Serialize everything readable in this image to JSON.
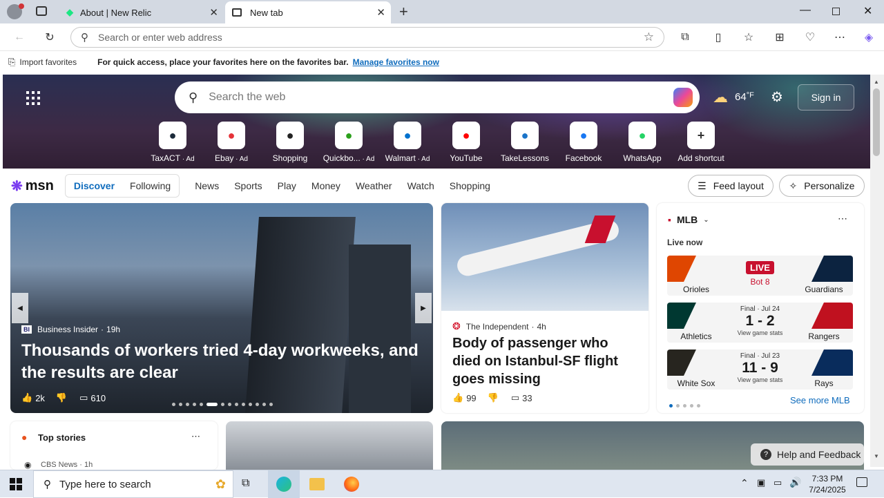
{
  "browser": {
    "tabs": [
      {
        "title": "About | New Relic"
      },
      {
        "title": "New tab"
      }
    ],
    "address_placeholder": "Search or enter web address"
  },
  "favbar": {
    "import_label": "Import favorites",
    "message": "For quick access, place your favorites here on the favorites bar.",
    "manage_link": "Manage favorites now"
  },
  "hero": {
    "search_placeholder": "Search the web",
    "weather_temp": "64",
    "weather_unit": "°F",
    "sign_in": "Sign in",
    "quicklinks": [
      {
        "label": "TaxACT",
        "ad": " · Ad",
        "icon": "taxact-icon",
        "color": "#1b2a3a"
      },
      {
        "label": "Ebay",
        "ad": " · Ad",
        "icon": "ebay-icon",
        "color": "#e53238"
      },
      {
        "label": "Shopping",
        "ad": "",
        "icon": "tag-icon",
        "color": "#222"
      },
      {
        "label": "Quickbo...",
        "ad": " · Ad",
        "icon": "quickbooks-icon",
        "color": "#2ca01c"
      },
      {
        "label": "Walmart",
        "ad": " · Ad",
        "icon": "walmart-icon",
        "color": "#0071ce"
      },
      {
        "label": "YouTube",
        "ad": "",
        "icon": "youtube-icon",
        "color": "#ff0000"
      },
      {
        "label": "TakeLessons",
        "ad": "",
        "icon": "takelessons-icon",
        "color": "#1a73c8"
      },
      {
        "label": "Facebook",
        "ad": "",
        "icon": "facebook-icon",
        "color": "#1877f2"
      },
      {
        "label": "WhatsApp",
        "ad": "",
        "icon": "whatsapp-icon",
        "color": "#25d366"
      },
      {
        "label": "Add shortcut",
        "ad": "",
        "icon": "plus-icon",
        "color": "#333"
      }
    ]
  },
  "msn": {
    "logo": "msn",
    "discover": "Discover",
    "following": "Following",
    "nav": [
      "News",
      "Sports",
      "Play",
      "Money",
      "Weather",
      "Watch",
      "Shopping"
    ],
    "feed_layout": "Feed layout",
    "personalize": "Personalize"
  },
  "main_story": {
    "source": "Business Insider",
    "time": "19h",
    "headline": "Thousands of workers tried 4-day workweeks, and the results are clear",
    "likes": "2k",
    "comments": "610"
  },
  "second_story": {
    "source": "The Independent",
    "time": "4h",
    "headline": "Body of passenger who died on Istanbul-SF flight goes missing",
    "likes": "99",
    "comments": "33"
  },
  "mlb": {
    "title": "MLB",
    "live_now": "Live now",
    "see_more": "See more MLB",
    "games": [
      {
        "away": "Orioles",
        "home": "Guardians",
        "status": "LIVE",
        "detail": "Bot 8",
        "score": "",
        "sub": "",
        "away_color": "#df4601",
        "home_color": "#0c2340"
      },
      {
        "away": "Athletics",
        "home": "Rangers",
        "status": "Final · Jul 24",
        "detail": "",
        "score": "1 - 2",
        "sub": "View game stats",
        "away_color": "#003831",
        "home_color": "#c0111f"
      },
      {
        "away": "White Sox",
        "home": "Rays",
        "status": "Final · Jul 23",
        "detail": "",
        "score": "11 - 9",
        "sub": "View game stats",
        "away_color": "#27251f",
        "home_color": "#092c5c"
      }
    ]
  },
  "top_stories": {
    "title": "Top stories",
    "source": "CBS News",
    "time": "1h"
  },
  "help": "Help and Feedback",
  "taskbar": {
    "search_placeholder": "Type here to search",
    "time": "7:33 PM",
    "date": "7/24/2025"
  }
}
